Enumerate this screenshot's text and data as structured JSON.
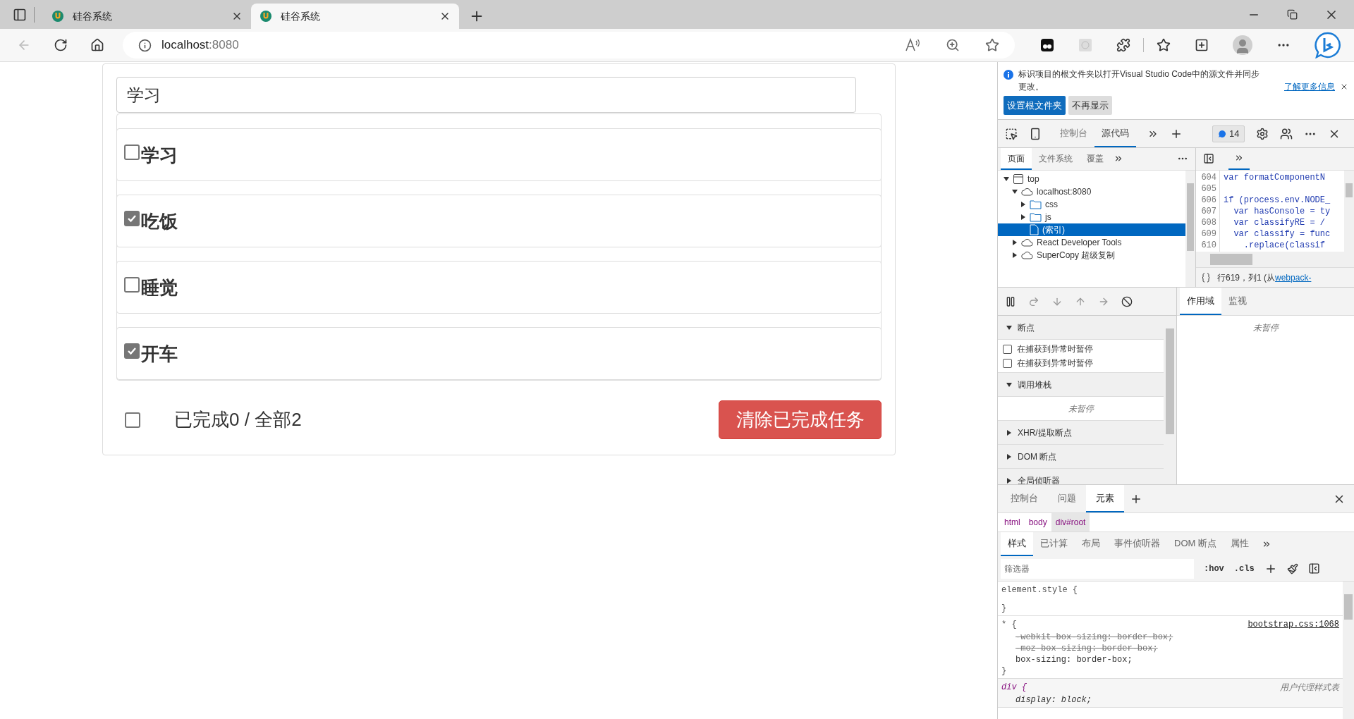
{
  "browser": {
    "tabs": [
      {
        "title": "硅谷系统",
        "selected": false
      },
      {
        "title": "硅谷系统",
        "selected": true
      }
    ],
    "address": {
      "host": "localhost",
      "port": ":8080"
    }
  },
  "page": {
    "input": {
      "value": "学习"
    },
    "todos": [
      {
        "text": "学习",
        "done": false
      },
      {
        "text": "吃饭",
        "done": true
      },
      {
        "text": "睡觉",
        "done": false
      },
      {
        "text": "开车",
        "done": true
      }
    ],
    "footer": {
      "all_checked": false,
      "summary": "已完成0 / 全部2",
      "clear_button": "清除已完成任务"
    }
  },
  "devtools": {
    "info_bar": {
      "message": "标识项目的根文件夹以打开Visual Studio Code中的源文件并同步更改。",
      "learn_more": "了解更多信息",
      "buttons": [
        {
          "label": "设置根文件夹",
          "primary": true
        },
        {
          "label": "不再显示",
          "primary": false
        }
      ]
    },
    "toolbar": {
      "tabs": [
        {
          "label": "控制台",
          "selected": false
        },
        {
          "label": "源代码",
          "selected": true
        }
      ],
      "issues_count": "14"
    },
    "navigator": {
      "tabs": [
        {
          "label": "页面",
          "selected": true
        },
        {
          "label": "文件系统",
          "selected": false
        },
        {
          "label": "覆盖",
          "selected": false
        }
      ],
      "tree": [
        {
          "label": "top",
          "kind": "frame",
          "expanded": true,
          "selected": false,
          "children": [
            {
              "label": "localhost:8080",
              "kind": "cloud",
              "expanded": true,
              "selected": false,
              "children": [
                {
                  "label": "css",
                  "kind": "folder",
                  "expanded": false,
                  "selected": false
                },
                {
                  "label": "js",
                  "kind": "folder",
                  "expanded": false,
                  "selected": false
                },
                {
                  "label": "(索引)",
                  "kind": "file",
                  "selected": true
                }
              ]
            },
            {
              "label": "React Developer Tools",
              "kind": "cloud",
              "expanded": false,
              "selected": false
            },
            {
              "label": "SuperCopy 超级复制",
              "kind": "cloud",
              "expanded": false,
              "selected": false
            }
          ]
        }
      ]
    },
    "editor": {
      "lines": [
        {
          "number": "604",
          "code": "var formatComponentN"
        },
        {
          "number": "605"
        },
        {
          "number": "606",
          "code": "if (process.env.NODE_"
        },
        {
          "number": "607",
          "code": "  var hasConsole = ty"
        },
        {
          "number": "608",
          "code": "  var classifyRE = /"
        },
        {
          "number": "609",
          "code": "  var classify = func"
        },
        {
          "number": "610",
          "code": "    .replace(classif"
        }
      ],
      "status": "行619，列1 (从",
      "status_link": "webpack-"
    },
    "debugger": {
      "sections": [
        {
          "title": "断点",
          "expanded": true,
          "kind": "checkboxes",
          "items": [
            {
              "label": "在捕获到异常时暂停",
              "checked": false
            },
            {
              "label": "在捕获到异常时暂停",
              "checked": false
            }
          ]
        },
        {
          "title": "调用堆栈",
          "expanded": true,
          "kind": "message",
          "message": "未暂停"
        },
        {
          "title": "XHR/提取断点",
          "expanded": false
        },
        {
          "title": "DOM 断点",
          "expanded": false
        },
        {
          "title": "全局侦听器",
          "expanded": false
        }
      ]
    },
    "scope": {
      "tabs": [
        {
          "label": "作用域",
          "selected": true
        },
        {
          "label": "监视",
          "selected": false
        }
      ],
      "message": "未暂停"
    },
    "drawer": {
      "tabs": [
        {
          "label": "控制台",
          "selected": false
        },
        {
          "label": "问题",
          "selected": false
        },
        {
          "label": "元素",
          "selected": true
        }
      ],
      "breadcrumbs": [
        {
          "label": "html",
          "selected": false
        },
        {
          "label": "body",
          "selected": false
        },
        {
          "label": "div#root",
          "selected": true
        }
      ],
      "style_tabs": [
        {
          "label": "样式",
          "selected": true
        },
        {
          "label": "已计算",
          "selected": false
        },
        {
          "label": "布局",
          "selected": false
        },
        {
          "label": "事件侦听器",
          "selected": false
        },
        {
          "label": "DOM 断点",
          "selected": false
        },
        {
          "label": "属性",
          "selected": false
        }
      ],
      "filter": {
        "placeholder": "筛选器"
      },
      "hov": ":hov",
      "cls": ".cls",
      "rules": [
        {
          "header": "element.style {",
          "closing": "}",
          "user_agent": false
        },
        {
          "header": "* {",
          "source": "bootstrap.css:1068",
          "closing": "}",
          "user_agent": false,
          "declarations": [
            {
              "text": "-webkit-box-sizing: border-box;",
              "struck": true
            },
            {
              "text": "-moz-box-sizing: border-box;",
              "struck": true
            },
            {
              "text": "box-sizing: border-box;",
              "struck": false
            }
          ]
        },
        {
          "header": "div {",
          "source": "用户代理样式表",
          "user_agent": true,
          "declarations": [
            {
              "text": "display: block;",
              "struck": false
            }
          ]
        }
      ]
    }
  }
}
